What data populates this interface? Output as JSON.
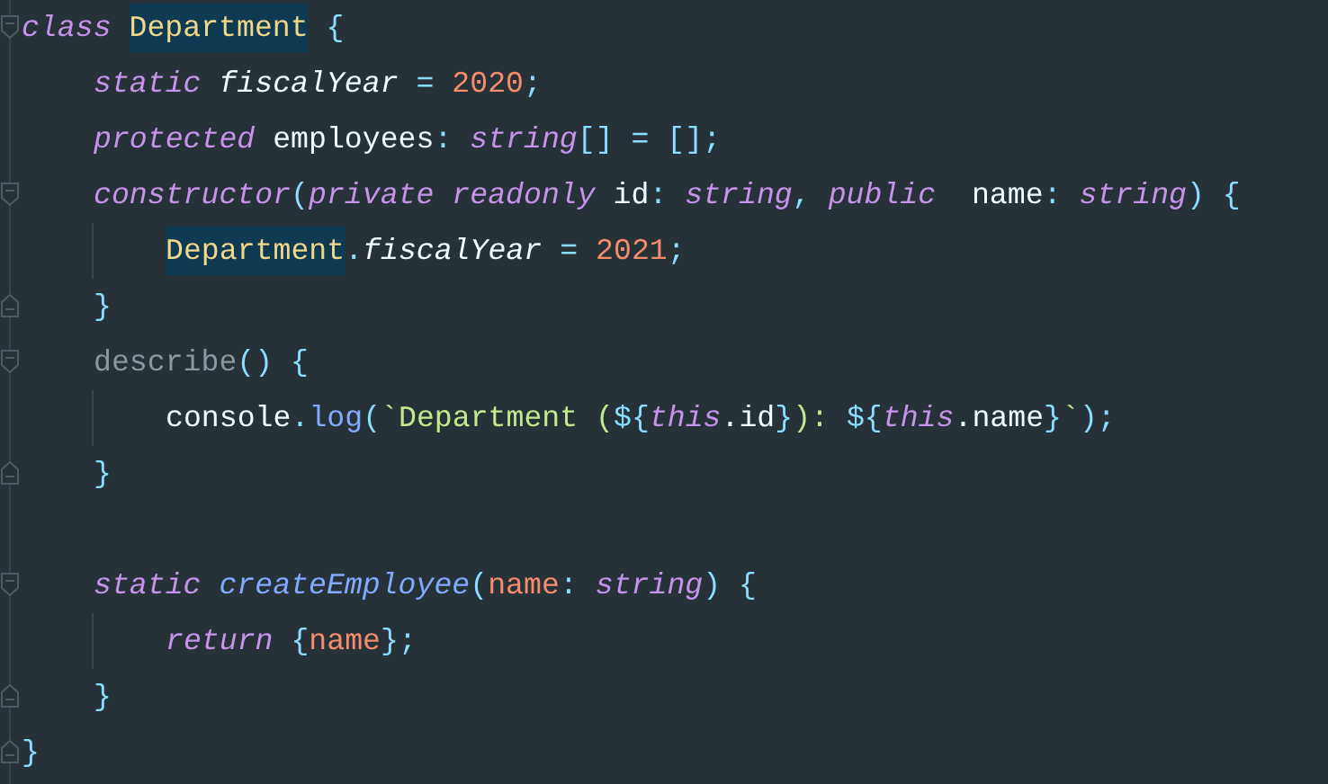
{
  "editor": {
    "lines": [
      {
        "kind": "code",
        "fold_start": true,
        "fold_end": false,
        "tokens": [
          {
            "t": "class ",
            "kind": "kw",
            "highlighted": false
          },
          {
            "t": "Department",
            "kind": "cls",
            "highlighted": true
          },
          {
            "t": " {",
            "kind": "punc",
            "highlighted": false
          }
        ],
        "children": [
          {
            "kind": "code",
            "fold_start": false,
            "fold_end": false,
            "tokens": [
              {
                "t": "static",
                "kind": "kw",
                "highlighted": false
              },
              {
                "t": " fiscalYear",
                "kind": "field",
                "highlighted": false
              },
              {
                "t": " = ",
                "kind": "punc",
                "highlighted": false
              },
              {
                "t": "2020",
                "kind": "num",
                "highlighted": false
              },
              {
                "t": ";",
                "kind": "punc",
                "highlighted": false
              }
            ]
          },
          {
            "kind": "code",
            "fold_start": false,
            "fold_end": false,
            "tokens": [
              {
                "t": "protected",
                "kind": "kw",
                "highlighted": false
              },
              {
                "t": " employees",
                "kind": "plain",
                "highlighted": false
              },
              {
                "t": ": ",
                "kind": "punc",
                "highlighted": false
              },
              {
                "t": "string",
                "kind": "kw",
                "highlighted": false
              },
              {
                "t": "[] = [];",
                "kind": "punc",
                "highlighted": false
              }
            ]
          },
          {
            "kind": "code",
            "fold_start": true,
            "fold_end": false,
            "tokens": [
              {
                "t": "constructor",
                "kind": "kw",
                "highlighted": false
              },
              {
                "t": "(",
                "kind": "punc",
                "highlighted": false
              },
              {
                "t": "private readonly",
                "kind": "kw",
                "highlighted": false
              },
              {
                "t": " id",
                "kind": "plain",
                "highlighted": false
              },
              {
                "t": ": ",
                "kind": "punc",
                "highlighted": false
              },
              {
                "t": "string",
                "kind": "kw",
                "highlighted": false
              },
              {
                "t": ", ",
                "kind": "punc",
                "highlighted": false
              },
              {
                "t": "public",
                "kind": "kw",
                "highlighted": false
              },
              {
                "t": "  name",
                "kind": "plain",
                "highlighted": false
              },
              {
                "t": ": ",
                "kind": "punc",
                "highlighted": false
              },
              {
                "t": "string",
                "kind": "kw",
                "highlighted": false
              },
              {
                "t": ") {",
                "kind": "punc",
                "highlighted": false
              }
            ],
            "children": [
              {
                "kind": "code",
                "fold_start": false,
                "fold_end": false,
                "tokens": [
                  {
                    "t": "Department",
                    "kind": "cls",
                    "highlighted": true
                  },
                  {
                    "t": ".",
                    "kind": "punc",
                    "highlighted": false
                  },
                  {
                    "t": "fiscalYear",
                    "kind": "field",
                    "highlighted": false
                  },
                  {
                    "t": " = ",
                    "kind": "punc",
                    "highlighted": false
                  },
                  {
                    "t": "2021",
                    "kind": "num",
                    "highlighted": false
                  },
                  {
                    "t": ";",
                    "kind": "punc",
                    "highlighted": false
                  }
                ]
              }
            ]
          },
          {
            "kind": "code",
            "fold_start": false,
            "fold_end": true,
            "tokens": [
              {
                "t": "}",
                "kind": "punc",
                "highlighted": false
              }
            ]
          },
          {
            "kind": "code",
            "fold_start": true,
            "fold_end": false,
            "tokens": [
              {
                "t": "describe",
                "kind": "dim",
                "highlighted": false
              },
              {
                "t": "() {",
                "kind": "punc",
                "highlighted": false
              }
            ],
            "children": [
              {
                "kind": "code",
                "fold_start": false,
                "fold_end": false,
                "tokens": [
                  {
                    "t": "console",
                    "kind": "plain",
                    "highlighted": false
                  },
                  {
                    "t": ".",
                    "kind": "punc",
                    "highlighted": false
                  },
                  {
                    "t": "log",
                    "kind": "fn",
                    "highlighted": false
                  },
                  {
                    "t": "(",
                    "kind": "punc",
                    "highlighted": false
                  },
                  {
                    "t": "`Department (",
                    "kind": "str",
                    "highlighted": false
                  },
                  {
                    "t": "${",
                    "kind": "punc",
                    "highlighted": false
                  },
                  {
                    "t": "this",
                    "kind": "kw",
                    "highlighted": false
                  },
                  {
                    "t": ".id",
                    "kind": "plain",
                    "highlighted": false
                  },
                  {
                    "t": "}",
                    "kind": "punc",
                    "highlighted": false
                  },
                  {
                    "t": "): ",
                    "kind": "str",
                    "highlighted": false
                  },
                  {
                    "t": "${",
                    "kind": "punc",
                    "highlighted": false
                  },
                  {
                    "t": "this",
                    "kind": "kw",
                    "highlighted": false
                  },
                  {
                    "t": ".name",
                    "kind": "plain",
                    "highlighted": false
                  },
                  {
                    "t": "}",
                    "kind": "punc",
                    "highlighted": false
                  },
                  {
                    "t": "`",
                    "kind": "str",
                    "highlighted": false
                  },
                  {
                    "t": ");",
                    "kind": "punc",
                    "highlighted": false
                  }
                ]
              }
            ]
          },
          {
            "kind": "code",
            "fold_start": false,
            "fold_end": true,
            "tokens": [
              {
                "t": "}",
                "kind": "punc",
                "highlighted": false
              }
            ]
          },
          {
            "kind": "blank"
          },
          {
            "kind": "code",
            "fold_start": true,
            "fold_end": false,
            "tokens": [
              {
                "t": "static",
                "kind": "kw",
                "highlighted": false
              },
              {
                "t": " createEmployee",
                "kind": "fnit",
                "highlighted": false
              },
              {
                "t": "(",
                "kind": "punc",
                "highlighted": false
              },
              {
                "t": "name",
                "kind": "param",
                "highlighted": false
              },
              {
                "t": ": ",
                "kind": "punc",
                "highlighted": false
              },
              {
                "t": "string",
                "kind": "kw",
                "highlighted": false
              },
              {
                "t": ") {",
                "kind": "punc",
                "highlighted": false
              }
            ],
            "children": [
              {
                "kind": "code",
                "fold_start": false,
                "fold_end": false,
                "tokens": [
                  {
                    "t": "return",
                    "kind": "kw",
                    "highlighted": false
                  },
                  {
                    "t": " {",
                    "kind": "punc",
                    "highlighted": false
                  },
                  {
                    "t": "name",
                    "kind": "param",
                    "highlighted": false
                  },
                  {
                    "t": "};",
                    "kind": "punc",
                    "highlighted": false
                  }
                ]
              }
            ]
          },
          {
            "kind": "code",
            "fold_start": false,
            "fold_end": true,
            "tokens": [
              {
                "t": "}",
                "kind": "punc",
                "highlighted": false
              }
            ]
          }
        ]
      },
      {
        "kind": "code",
        "fold_start": false,
        "fold_end": true,
        "tokens": [
          {
            "t": "}",
            "kind": "punc",
            "highlighted": false
          }
        ]
      }
    ]
  }
}
